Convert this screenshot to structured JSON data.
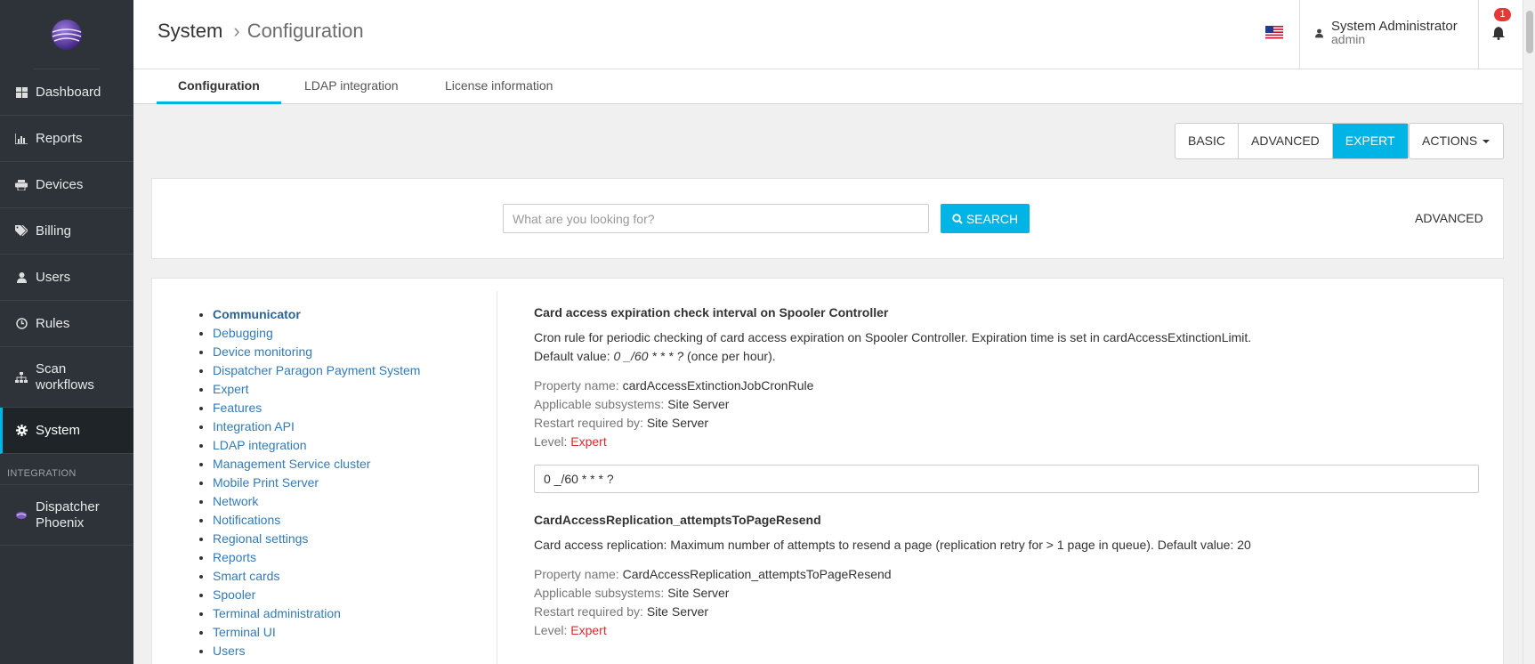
{
  "sidebar": {
    "items": [
      {
        "label": "Dashboard",
        "icon": "dashboard-icon"
      },
      {
        "label": "Reports",
        "icon": "bar-chart-icon"
      },
      {
        "label": "Devices",
        "icon": "printer-icon"
      },
      {
        "label": "Billing",
        "icon": "tags-icon"
      },
      {
        "label": "Users",
        "icon": "user-icon"
      },
      {
        "label": "Rules",
        "icon": "clock-icon"
      },
      {
        "label": "Scan workflows",
        "icon": "sitemap-icon"
      },
      {
        "label": "System",
        "icon": "gear-icon",
        "active": true
      }
    ],
    "section_label": "INTEGRATION",
    "integration_items": [
      {
        "label": "Dispatcher Phoenix",
        "icon": "phoenix-logo-icon"
      }
    ]
  },
  "header": {
    "breadcrumb": [
      "System",
      "Configuration"
    ],
    "user_name": "System Administrator",
    "user_login": "admin",
    "notification_count": "1"
  },
  "tabs": [
    {
      "label": "Configuration",
      "active": true
    },
    {
      "label": "LDAP integration"
    },
    {
      "label": "License information"
    }
  ],
  "levels": {
    "basic": "BASIC",
    "advanced": "ADVANCED",
    "expert": "EXPERT",
    "active": "EXPERT"
  },
  "actions_label": "ACTIONS",
  "search": {
    "placeholder": "What are you looking for?",
    "button_label": "SEARCH",
    "advanced_label": "ADVANCED"
  },
  "categories": [
    "Communicator",
    "Debugging",
    "Device monitoring",
    "Dispatcher Paragon Payment System",
    "Expert",
    "Features",
    "Integration API",
    "LDAP integration",
    "Management Service cluster",
    "Mobile Print Server",
    "Network",
    "Notifications",
    "Regional settings",
    "Reports",
    "Smart cards",
    "Spooler",
    "Terminal administration",
    "Terminal UI",
    "Users"
  ],
  "active_category": "Communicator",
  "meta_labels": {
    "property_name": "Property name:",
    "subsystems": "Applicable subsystems:",
    "restart": "Restart required by:",
    "level": "Level:"
  },
  "properties": [
    {
      "title": "Card access expiration check interval on Spooler Controller",
      "description": "Cron rule for periodic checking of card access expiration on Spooler Controller. Expiration time is set in cardAccessExtinctionLimit.",
      "default_prefix": "Default value:",
      "default_value": "0 _/60 * * * ?",
      "default_suffix": "(once per hour).",
      "property_name": "cardAccessExtinctionJobCronRule",
      "subsystems": "Site Server",
      "restart": "Site Server",
      "level": "Expert",
      "value": "0 _/60 * * * ?"
    },
    {
      "title": "CardAccessReplication_attemptsToPageResend",
      "description": "Card access replication: Maximum number of attempts to resend a page (replication retry for > 1 page in queue). Default value: 20",
      "property_name": "CardAccessReplication_attemptsToPageResend",
      "subsystems": "Site Server",
      "restart": "Site Server",
      "level": "Expert"
    }
  ],
  "colors": {
    "accent": "#00b4e6",
    "sidebar_bg": "#2d3339",
    "link": "#337ab7",
    "level_expert": "#d32f2f"
  }
}
